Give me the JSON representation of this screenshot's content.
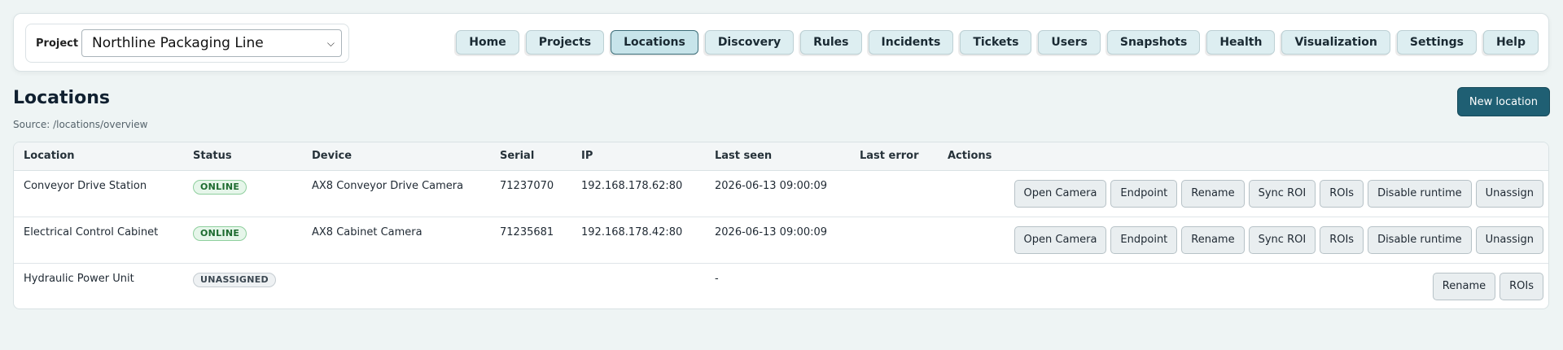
{
  "project": {
    "label": "Project",
    "selected": "Northline Packaging Line"
  },
  "nav": [
    "Home",
    "Projects",
    "Locations",
    "Discovery",
    "Rules",
    "Incidents",
    "Tickets",
    "Users",
    "Snapshots",
    "Health",
    "Visualization",
    "Settings",
    "Help"
  ],
  "nav_active": "Locations",
  "page": {
    "title": "Locations",
    "source": "Source: /locations/overview",
    "new_button": "New location"
  },
  "table": {
    "headers": {
      "location": "Location",
      "status": "Status",
      "device": "Device",
      "serial": "Serial",
      "ip": "IP",
      "last_seen": "Last seen",
      "last_error": "Last error",
      "actions": "Actions"
    },
    "rows": [
      {
        "location": "Conveyor Drive Station",
        "status": "ONLINE",
        "device": "AX8 Conveyor Drive Camera",
        "serial": "71237070",
        "ip": "192.168.178.62:80",
        "last_seen": "2026-06-13 09:00:09",
        "last_error": "",
        "actions": [
          "Open Camera",
          "Endpoint",
          "Rename",
          "Sync ROI",
          "ROIs",
          "Disable runtime",
          "Unassign"
        ]
      },
      {
        "location": "Electrical Control Cabinet",
        "status": "ONLINE",
        "device": "AX8 Cabinet Camera",
        "serial": "71235681",
        "ip": "192.168.178.42:80",
        "last_seen": "2026-06-13 09:00:09",
        "last_error": "",
        "actions": [
          "Open Camera",
          "Endpoint",
          "Rename",
          "Sync ROI",
          "ROIs",
          "Disable runtime",
          "Unassign"
        ]
      },
      {
        "location": "Hydraulic Power Unit",
        "status": "UNASSIGNED",
        "device": "",
        "serial": "",
        "ip": "",
        "last_seen": "-",
        "last_error": "",
        "actions": [
          "Rename",
          "ROIs"
        ]
      }
    ]
  },
  "colors": {
    "accent": "#1f5f73",
    "online_bg": "#e6f6ea",
    "online_text": "#1d6b2f"
  }
}
